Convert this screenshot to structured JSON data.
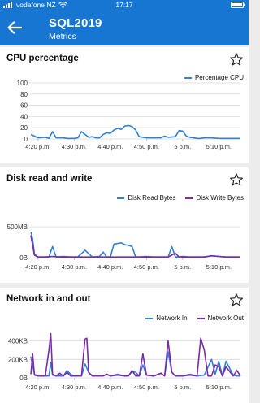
{
  "status_bar": {
    "carrier": "vodafone NZ",
    "time": "17:17"
  },
  "header": {
    "back_icon": "arrow-left-icon",
    "title": "SQL2019",
    "subtitle": "Metrics"
  },
  "colors": {
    "app_bar": "#1676d2",
    "blue_series": "#2f80d4",
    "purple_series": "#7a2ba6"
  },
  "cards": [
    {
      "title": "CPU percentage",
      "star_icon": "star-outline-icon"
    },
    {
      "title": "Disk read and write",
      "star_icon": "star-outline-icon"
    },
    {
      "title": "Network in and out",
      "star_icon": "star-outline-icon"
    }
  ],
  "chart_data": [
    {
      "type": "line",
      "title": "CPU percentage",
      "yticks": [
        "100",
        "80",
        "60",
        "40",
        "20",
        "0"
      ],
      "ylim": [
        0,
        100
      ],
      "xticks": [
        "4:20 p.m.",
        "4:30 p.m.",
        "4:40 p.m.",
        "4:50 p.m.",
        "5 p.m.",
        "5:10 p.m."
      ],
      "x_minutes_range": [
        0,
        58
      ],
      "series": [
        {
          "name": "Percentage CPU",
          "color": "#2f80d4",
          "x": [
            0,
            1,
            2,
            4,
            5,
            6,
            7,
            9,
            10,
            11,
            12,
            13,
            14,
            16,
            17,
            18,
            19,
            20,
            21,
            22,
            23,
            24,
            25,
            26,
            27,
            28,
            29,
            30,
            31,
            32,
            33,
            34,
            35,
            36,
            37,
            38,
            40,
            41,
            42,
            43,
            44,
            45,
            46,
            47,
            48,
            50,
            52,
            54,
            56,
            58
          ],
          "y": [
            8,
            5,
            2,
            3,
            1,
            13,
            2,
            2,
            1,
            1,
            1,
            2,
            13,
            3,
            4,
            2,
            2,
            8,
            11,
            10,
            16,
            19,
            17,
            23,
            24,
            22,
            16,
            4,
            3,
            2,
            2,
            2,
            2,
            2,
            5,
            3,
            4,
            15,
            14,
            5,
            3,
            2,
            1,
            1,
            2,
            2,
            1,
            1,
            1,
            1
          ]
        }
      ]
    },
    {
      "type": "line",
      "title": "Disk read and write",
      "yticks": [
        "500MB",
        "0B"
      ],
      "ylim": [
        0,
        700
      ],
      "xticks": [
        "4:20 p.m.",
        "4:30 p.m.",
        "4:40 p.m.",
        "4:50 p.m.",
        "5 p.m.",
        "5:10 p.m."
      ],
      "x_minutes_range": [
        0,
        58
      ],
      "series": [
        {
          "name": "Disk Read Bytes",
          "color": "#2f80d4",
          "x": [
            0,
            0.5,
            1,
            2,
            4,
            5,
            6,
            7,
            9,
            11,
            13,
            15,
            17,
            19,
            20,
            21,
            22,
            23,
            24,
            25,
            26,
            27,
            28,
            29,
            30,
            32,
            34,
            36,
            38,
            39,
            40,
            41,
            42,
            44,
            46,
            48,
            50,
            52,
            54,
            56,
            58
          ],
          "y": [
            420,
            300,
            60,
            10,
            10,
            10,
            180,
            10,
            20,
            10,
            10,
            120,
            10,
            20,
            90,
            10,
            10,
            220,
            230,
            240,
            210,
            200,
            180,
            10,
            10,
            20,
            10,
            10,
            10,
            180,
            10,
            10,
            20,
            10,
            10,
            10,
            30,
            20,
            10,
            10,
            10
          ]
        },
        {
          "name": "Disk Write Bytes",
          "color": "#7a2ba6",
          "x": [
            0,
            0.5,
            1,
            2,
            4,
            6,
            8,
            10,
            12,
            14,
            16,
            18,
            20,
            22,
            24,
            26,
            28,
            30,
            32,
            34,
            36,
            38,
            40,
            41,
            42,
            44,
            46,
            48,
            50,
            52,
            54,
            56,
            58
          ],
          "y": [
            360,
            200,
            40,
            10,
            10,
            20,
            10,
            10,
            10,
            10,
            10,
            10,
            10,
            10,
            10,
            10,
            10,
            10,
            10,
            10,
            10,
            10,
            70,
            10,
            10,
            10,
            10,
            10,
            30,
            20,
            10,
            10,
            10
          ]
        }
      ]
    },
    {
      "type": "line",
      "title": "Network in and out",
      "yticks": [
        "400KB",
        "200KB",
        "0B"
      ],
      "ylim": [
        0,
        520
      ],
      "xticks": [
        "4:20 p.m.",
        "4:30 p.m.",
        "4:40 p.m.",
        "4:50 p.m.",
        "5 p.m.",
        "5:10 p.m."
      ],
      "x_minutes_range": [
        0,
        58
      ],
      "series": [
        {
          "name": "Network In",
          "color": "#2f80d4",
          "x": [
            0,
            1,
            2,
            4,
            5,
            5.5,
            6,
            7,
            8,
            9,
            10,
            11,
            12,
            13,
            14,
            15,
            16,
            17,
            18,
            20,
            21,
            22,
            24,
            26,
            27,
            28,
            29,
            30,
            31,
            32,
            34,
            36,
            37,
            38,
            39,
            40,
            42,
            44,
            46,
            48,
            50,
            51,
            52,
            53,
            54,
            56,
            57,
            58
          ],
          "y": [
            230,
            40,
            20,
            20,
            20,
            170,
            30,
            20,
            20,
            20,
            80,
            40,
            20,
            20,
            20,
            150,
            60,
            20,
            20,
            20,
            40,
            20,
            40,
            20,
            20,
            70,
            60,
            20,
            140,
            30,
            20,
            50,
            20,
            280,
            60,
            20,
            20,
            40,
            20,
            30,
            200,
            40,
            180,
            20,
            180,
            30,
            20,
            20
          ]
        },
        {
          "name": "Network Out",
          "color": "#7a2ba6",
          "x": [
            0,
            0.5,
            1,
            2,
            4,
            5,
            5.5,
            6,
            7,
            8,
            9,
            10,
            11,
            12,
            14,
            15,
            15.5,
            16,
            17,
            18,
            20,
            21,
            22,
            24,
            26,
            27,
            28,
            29,
            30,
            31,
            32,
            34,
            36,
            37,
            38,
            39,
            40,
            42,
            44,
            46,
            47,
            48,
            49,
            50,
            51,
            52,
            53,
            54,
            56,
            57,
            58
          ],
          "y": [
            40,
            260,
            30,
            20,
            20,
            300,
            480,
            40,
            20,
            50,
            20,
            60,
            20,
            20,
            20,
            420,
            430,
            60,
            20,
            20,
            20,
            40,
            20,
            30,
            20,
            20,
            80,
            20,
            20,
            260,
            30,
            20,
            50,
            20,
            400,
            60,
            20,
            20,
            30,
            20,
            430,
            300,
            20,
            20,
            140,
            120,
            20,
            120,
            20,
            80,
            20
          ]
        }
      ]
    }
  ]
}
